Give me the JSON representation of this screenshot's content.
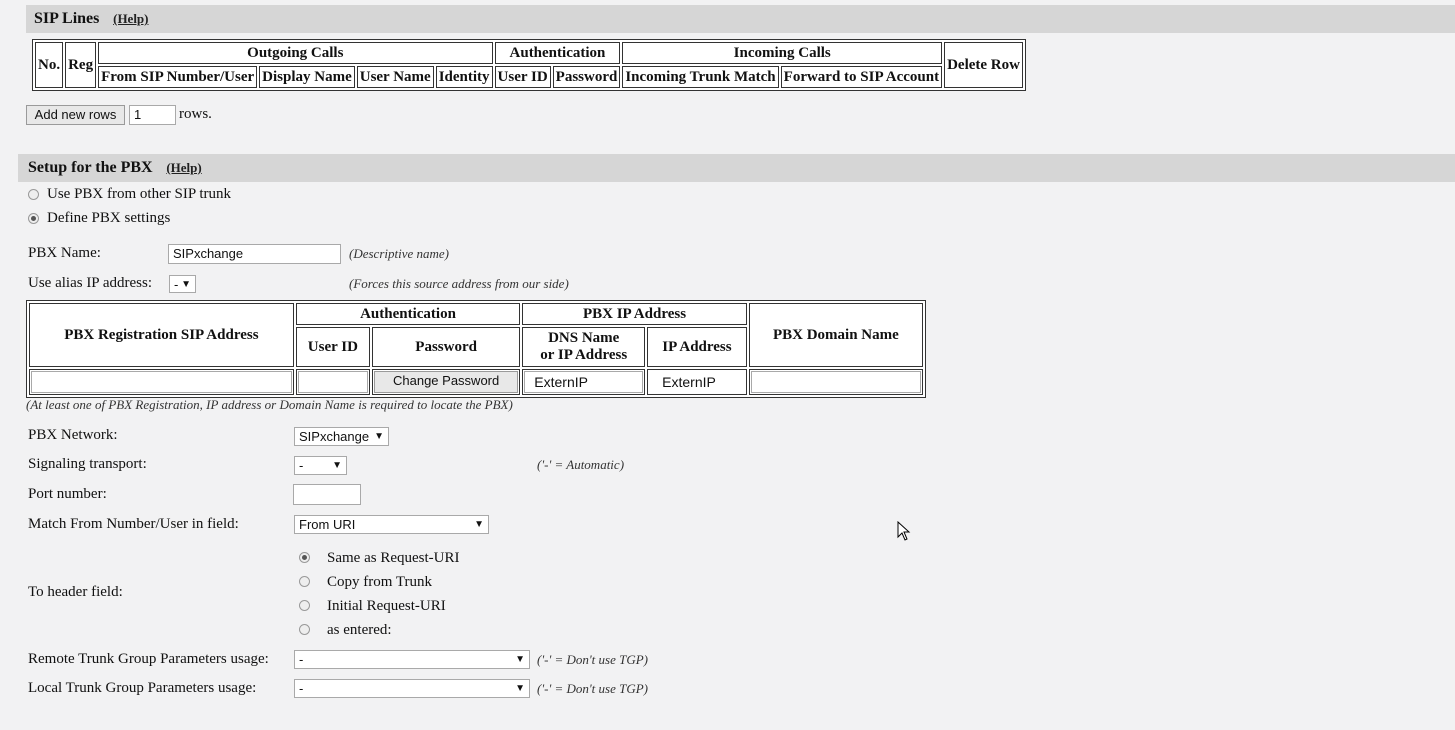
{
  "sip_lines": {
    "title": "SIP Lines",
    "help": "(Help)",
    "headers": {
      "no": "No.",
      "reg": "Reg",
      "outgoing": "Outgoing Calls",
      "authentication": "Authentication",
      "incoming": "Incoming Calls",
      "delete_row": "Delete Row",
      "from_sip": "From SIP Number/User",
      "display_name": "Display Name",
      "user_name": "User Name",
      "identity": "Identity",
      "user_id": "User ID",
      "password": "Password",
      "incoming_trunk": "Incoming Trunk Match",
      "forward_sip": "Forward to SIP Account"
    },
    "add_rows_button": "Add new rows",
    "rows_count": "1",
    "rows_suffix": "rows."
  },
  "pbx": {
    "title": "Setup for the PBX",
    "help": "(Help)",
    "option_other_trunk": "Use PBX from other SIP trunk",
    "option_define": "Define PBX settings",
    "name_label": "PBX Name:",
    "name_value": "SIPxchange",
    "name_hint": "(Descriptive name)",
    "alias_label": "Use alias IP address:",
    "alias_value": "-",
    "alias_hint": "(Forces this source address from our side)",
    "table": {
      "reg_sip": "PBX Registration SIP Address",
      "authentication": "Authentication",
      "pbx_ip": "PBX IP Address",
      "domain": "PBX Domain Name",
      "user_id": "User ID",
      "password": "Password",
      "dns_line1": "DNS Name",
      "dns_line2": "or IP Address",
      "ip_address": "IP Address",
      "change_password": "Change Password",
      "dns_value": "ExternIP",
      "ip_value": "ExternIP"
    },
    "locate_note": "(At least one of PBX Registration, IP address or Domain Name is required to locate the PBX)",
    "network_label": "PBX Network:",
    "network_value": "SIPxchange",
    "transport_label": "Signaling transport:",
    "transport_value": "-",
    "transport_hint": "('-' = Automatic)",
    "port_label": "Port number:",
    "port_value": "",
    "match_label": "Match From Number/User in field:",
    "match_value": "From URI",
    "to_header_label": "To header field:",
    "to_options": [
      "Same as Request-URI",
      "Copy from Trunk",
      "Initial Request-URI",
      "as entered:"
    ],
    "remote_tgp_label": "Remote Trunk Group Parameters usage:",
    "remote_tgp_value": "-",
    "local_tgp_label": "Local Trunk Group Parameters usage:",
    "local_tgp_value": "-",
    "tgp_hint": "('-' = Don't use TGP)"
  }
}
